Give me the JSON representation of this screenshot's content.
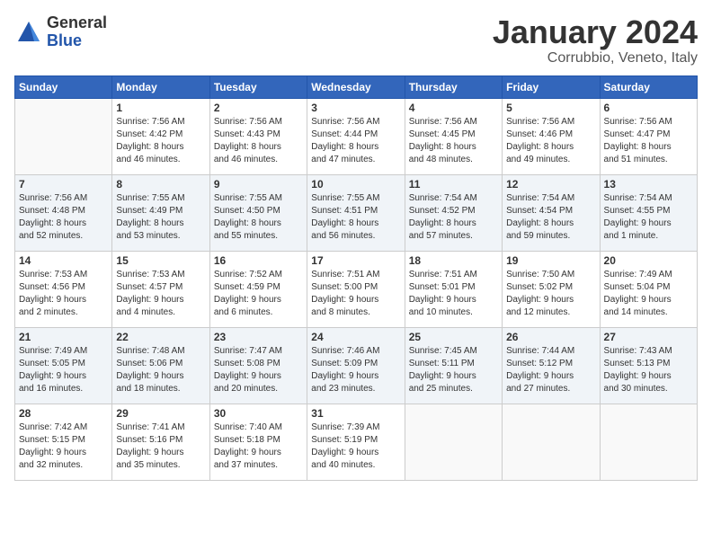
{
  "logo": {
    "general": "General",
    "blue": "Blue"
  },
  "title": {
    "month": "January 2024",
    "location": "Corrubbio, Veneto, Italy"
  },
  "days_header": [
    "Sunday",
    "Monday",
    "Tuesday",
    "Wednesday",
    "Thursday",
    "Friday",
    "Saturday"
  ],
  "weeks": [
    [
      {
        "day": "",
        "info": ""
      },
      {
        "day": "1",
        "info": "Sunrise: 7:56 AM\nSunset: 4:42 PM\nDaylight: 8 hours\nand 46 minutes."
      },
      {
        "day": "2",
        "info": "Sunrise: 7:56 AM\nSunset: 4:43 PM\nDaylight: 8 hours\nand 46 minutes."
      },
      {
        "day": "3",
        "info": "Sunrise: 7:56 AM\nSunset: 4:44 PM\nDaylight: 8 hours\nand 47 minutes."
      },
      {
        "day": "4",
        "info": "Sunrise: 7:56 AM\nSunset: 4:45 PM\nDaylight: 8 hours\nand 48 minutes."
      },
      {
        "day": "5",
        "info": "Sunrise: 7:56 AM\nSunset: 4:46 PM\nDaylight: 8 hours\nand 49 minutes."
      },
      {
        "day": "6",
        "info": "Sunrise: 7:56 AM\nSunset: 4:47 PM\nDaylight: 8 hours\nand 51 minutes."
      }
    ],
    [
      {
        "day": "7",
        "info": "Sunrise: 7:56 AM\nSunset: 4:48 PM\nDaylight: 8 hours\nand 52 minutes."
      },
      {
        "day": "8",
        "info": "Sunrise: 7:55 AM\nSunset: 4:49 PM\nDaylight: 8 hours\nand 53 minutes."
      },
      {
        "day": "9",
        "info": "Sunrise: 7:55 AM\nSunset: 4:50 PM\nDaylight: 8 hours\nand 55 minutes."
      },
      {
        "day": "10",
        "info": "Sunrise: 7:55 AM\nSunset: 4:51 PM\nDaylight: 8 hours\nand 56 minutes."
      },
      {
        "day": "11",
        "info": "Sunrise: 7:54 AM\nSunset: 4:52 PM\nDaylight: 8 hours\nand 57 minutes."
      },
      {
        "day": "12",
        "info": "Sunrise: 7:54 AM\nSunset: 4:54 PM\nDaylight: 8 hours\nand 59 minutes."
      },
      {
        "day": "13",
        "info": "Sunrise: 7:54 AM\nSunset: 4:55 PM\nDaylight: 9 hours\nand 1 minute."
      }
    ],
    [
      {
        "day": "14",
        "info": "Sunrise: 7:53 AM\nSunset: 4:56 PM\nDaylight: 9 hours\nand 2 minutes."
      },
      {
        "day": "15",
        "info": "Sunrise: 7:53 AM\nSunset: 4:57 PM\nDaylight: 9 hours\nand 4 minutes."
      },
      {
        "day": "16",
        "info": "Sunrise: 7:52 AM\nSunset: 4:59 PM\nDaylight: 9 hours\nand 6 minutes."
      },
      {
        "day": "17",
        "info": "Sunrise: 7:51 AM\nSunset: 5:00 PM\nDaylight: 9 hours\nand 8 minutes."
      },
      {
        "day": "18",
        "info": "Sunrise: 7:51 AM\nSunset: 5:01 PM\nDaylight: 9 hours\nand 10 minutes."
      },
      {
        "day": "19",
        "info": "Sunrise: 7:50 AM\nSunset: 5:02 PM\nDaylight: 9 hours\nand 12 minutes."
      },
      {
        "day": "20",
        "info": "Sunrise: 7:49 AM\nSunset: 5:04 PM\nDaylight: 9 hours\nand 14 minutes."
      }
    ],
    [
      {
        "day": "21",
        "info": "Sunrise: 7:49 AM\nSunset: 5:05 PM\nDaylight: 9 hours\nand 16 minutes."
      },
      {
        "day": "22",
        "info": "Sunrise: 7:48 AM\nSunset: 5:06 PM\nDaylight: 9 hours\nand 18 minutes."
      },
      {
        "day": "23",
        "info": "Sunrise: 7:47 AM\nSunset: 5:08 PM\nDaylight: 9 hours\nand 20 minutes."
      },
      {
        "day": "24",
        "info": "Sunrise: 7:46 AM\nSunset: 5:09 PM\nDaylight: 9 hours\nand 23 minutes."
      },
      {
        "day": "25",
        "info": "Sunrise: 7:45 AM\nSunset: 5:11 PM\nDaylight: 9 hours\nand 25 minutes."
      },
      {
        "day": "26",
        "info": "Sunrise: 7:44 AM\nSunset: 5:12 PM\nDaylight: 9 hours\nand 27 minutes."
      },
      {
        "day": "27",
        "info": "Sunrise: 7:43 AM\nSunset: 5:13 PM\nDaylight: 9 hours\nand 30 minutes."
      }
    ],
    [
      {
        "day": "28",
        "info": "Sunrise: 7:42 AM\nSunset: 5:15 PM\nDaylight: 9 hours\nand 32 minutes."
      },
      {
        "day": "29",
        "info": "Sunrise: 7:41 AM\nSunset: 5:16 PM\nDaylight: 9 hours\nand 35 minutes."
      },
      {
        "day": "30",
        "info": "Sunrise: 7:40 AM\nSunset: 5:18 PM\nDaylight: 9 hours\nand 37 minutes."
      },
      {
        "day": "31",
        "info": "Sunrise: 7:39 AM\nSunset: 5:19 PM\nDaylight: 9 hours\nand 40 minutes."
      },
      {
        "day": "",
        "info": ""
      },
      {
        "day": "",
        "info": ""
      },
      {
        "day": "",
        "info": ""
      }
    ]
  ]
}
